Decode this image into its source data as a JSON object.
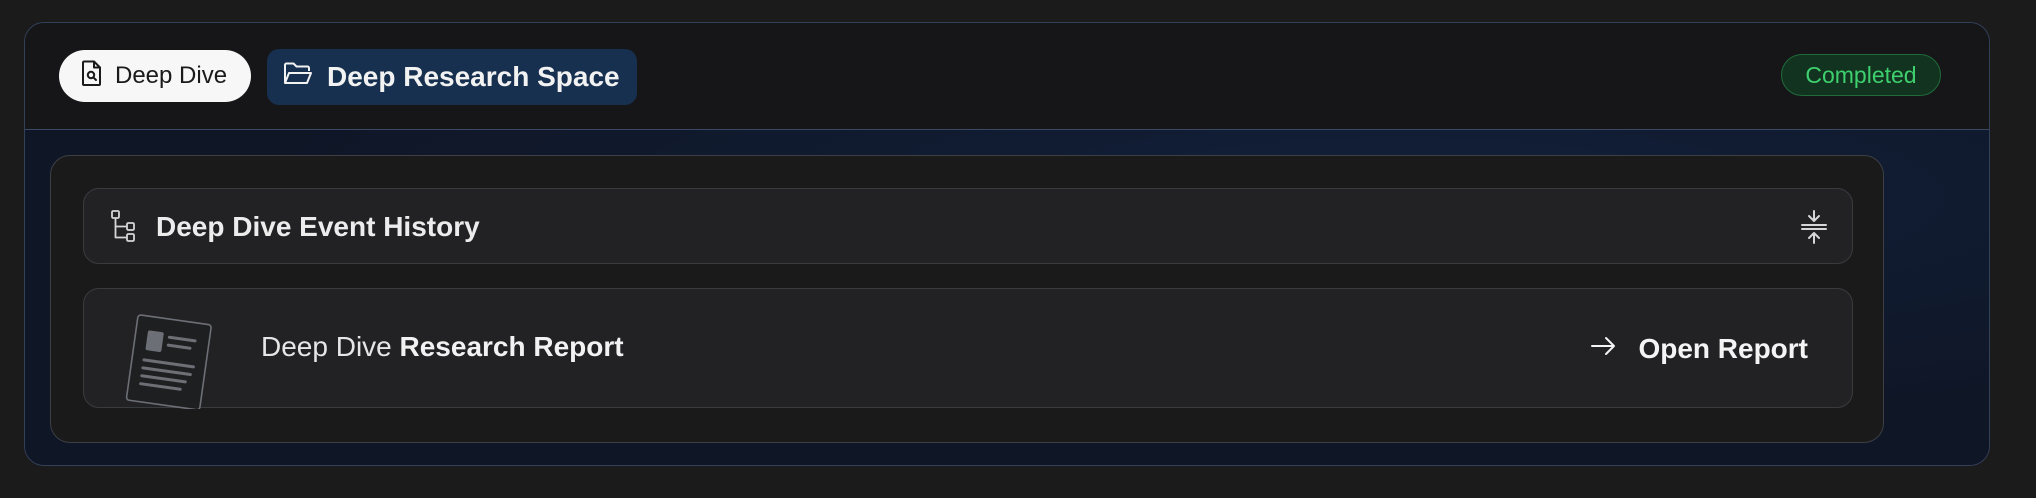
{
  "header": {
    "deep_dive_pill": "Deep Dive",
    "space_pill": "Deep Research Space",
    "status_badge": "Completed"
  },
  "history_row": {
    "label": "Deep Dive Event History"
  },
  "report_row": {
    "title_prefix": "Deep Dive",
    "title_bold": "Research Report",
    "open_label": "Open Report"
  },
  "colors": {
    "status_green": "#3ecf6e",
    "space_pill_bg": "#17304f",
    "card_border": "#34405a"
  },
  "icons": {
    "deep_dive": "document-search-icon",
    "space": "folder-open-icon",
    "history": "tree-structure-icon",
    "collapse": "collapse-vertical-icon",
    "thumbnail": "report-document-icon",
    "open": "arrow-right-icon"
  }
}
